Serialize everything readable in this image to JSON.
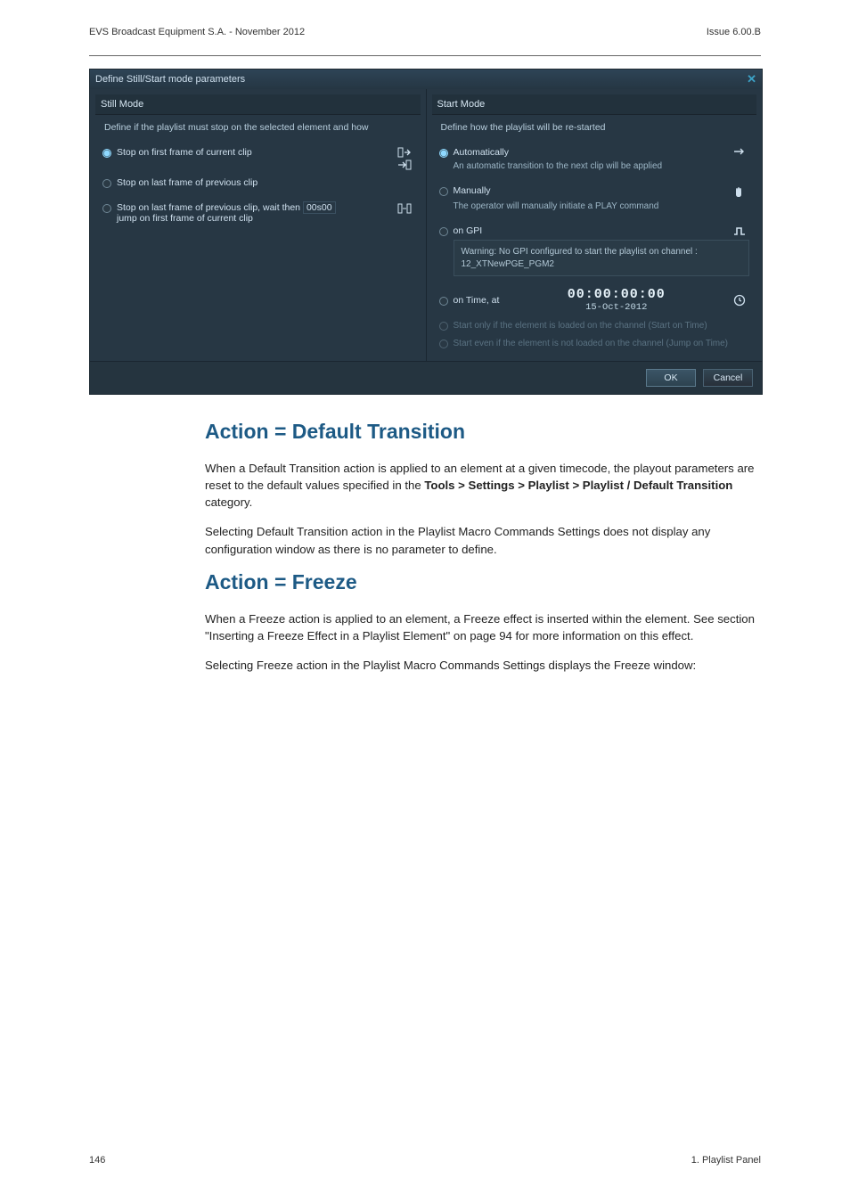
{
  "header": {
    "left": "EVS Broadcast Equipment S.A. - November 2012",
    "right": "Issue 6.00.B"
  },
  "dialog": {
    "title": "Define Still/Start mode parameters",
    "still": {
      "heading": "Still Mode",
      "sub": "Define if the playlist must stop on  the selected element and how",
      "opts": {
        "first": {
          "label": "Stop on first frame of current clip",
          "selected": true
        },
        "last": {
          "label": "Stop on last frame of previous clip"
        },
        "wait": {
          "pre": "Stop on last frame of previous clip, wait then",
          "box": "00s00",
          "post": "jump on first frame of current clip"
        }
      }
    },
    "start": {
      "heading": "Start Mode",
      "sub": "Define how the playlist will be re-started",
      "auto": {
        "label": "Automatically",
        "desc": "An automatic transition to the next clip will be applied",
        "selected": true
      },
      "manual": {
        "label": "Manually",
        "desc": "The operator will manually initiate a PLAY command"
      },
      "gpi": {
        "label": "on GPI",
        "warn": "Warning: No GPI configured to start the playlist on channel : 12_XTNewPGE_PGM2"
      },
      "time": {
        "label": "on Time, at",
        "tc": "00:00:00:00",
        "date": "15-Oct-2012"
      },
      "dim1": "Start only if the element is loaded on the channel (Start on Time)",
      "dim2": "Start even if the element is not loaded on the channel (Jump on Time)"
    },
    "buttons": {
      "ok": "OK",
      "cancel": "Cancel"
    }
  },
  "sections": {
    "defTrans": {
      "title": "Action = Default Transition",
      "p1a": "When a Default Transition action is applied to an element at a given timecode, the playout parameters are reset to the default values specified in the ",
      "p1bold": "Tools > Settings > Playlist > Playlist / Default Transition",
      "p1b": " category.",
      "p2": "Selecting Default Transition action in the Playlist Macro Commands Settings does not display any configuration window as there is no parameter to define."
    },
    "freeze": {
      "title": "Action = Freeze",
      "p1": "When a Freeze action is applied to an element, a Freeze effect is inserted within the element. See section \"Inserting a Freeze Effect in a Playlist Element\" on page 94 for more information on this effect.",
      "p2": "Selecting Freeze action in the Playlist Macro Commands Settings displays the Freeze window:"
    }
  },
  "footer": {
    "left": "146",
    "right": "1. Playlist Panel"
  }
}
